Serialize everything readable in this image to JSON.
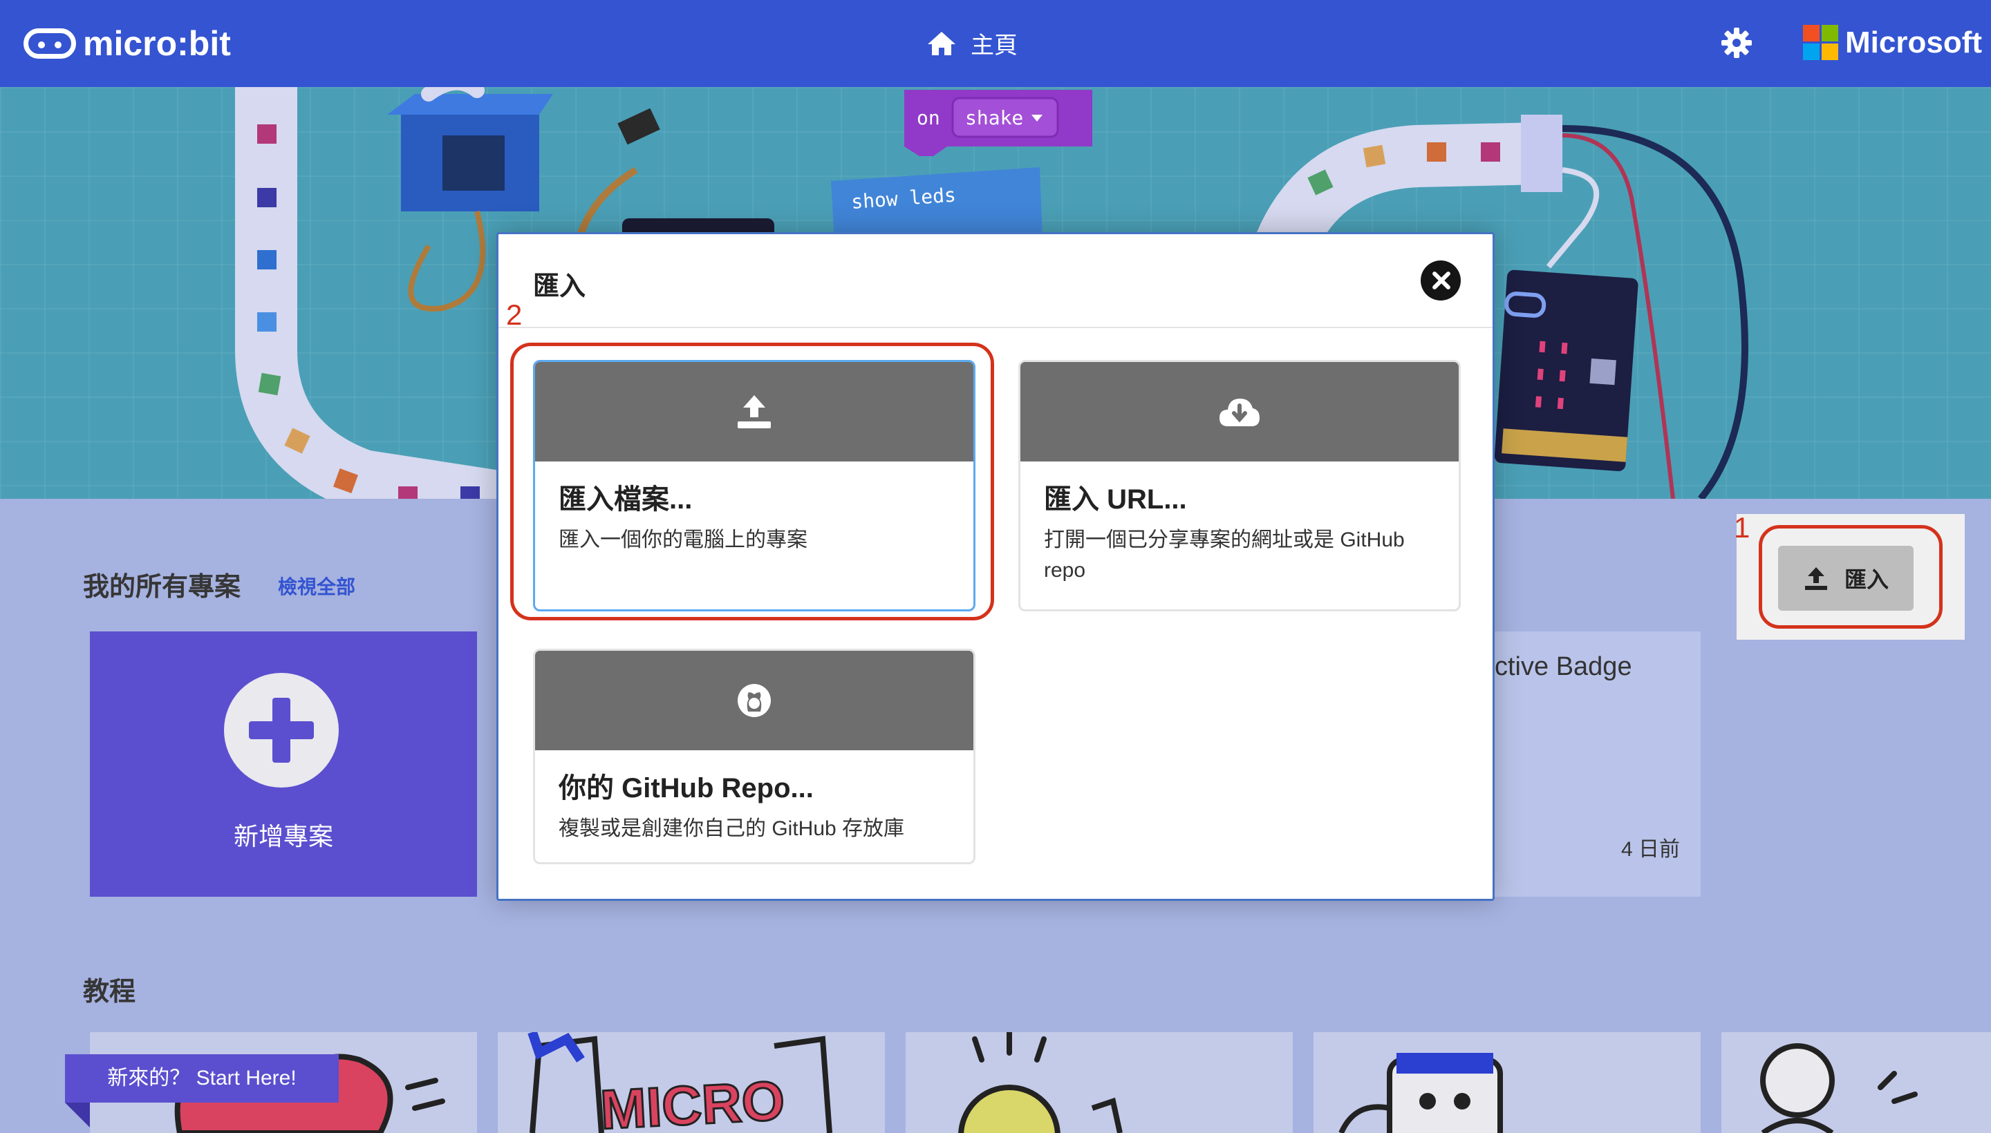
{
  "header": {
    "brand": "micro:bit",
    "home_label": "主頁",
    "microsoft": "Microsoft"
  },
  "hero": {
    "block_event": "on",
    "block_shake": "shake",
    "block_show_leds": "show leds"
  },
  "projects": {
    "section_title": "我的所有專案",
    "view_all": "檢視全部",
    "new_project_label": "新增專案",
    "card_title": "ctive Badge",
    "card_date": "4 日前"
  },
  "import_button": {
    "label": "匯入"
  },
  "tutorials": {
    "section_title": "教程",
    "start_banner": "新來的？ Start Here!"
  },
  "annotations": {
    "callout_1": "1",
    "callout_2": "2"
  },
  "modal": {
    "title": "匯入",
    "options": [
      {
        "title": "匯入檔案...",
        "description": "匯入一個你的電腦上的專案",
        "icon": "upload-icon"
      },
      {
        "title": "匯入 URL...",
        "description": "打開一個已分享專案的網址或是 GitHub repo",
        "icon": "cloud-download-icon"
      },
      {
        "title": "你的 GitHub Repo...",
        "description": "複製或是創建你自己的 GitHub 存放庫",
        "icon": "github-icon"
      }
    ]
  },
  "colors": {
    "header_bg": "#3454d1",
    "accent_purple": "#5b4fcf",
    "annotation_red": "#d4321c",
    "option_header_gray": "#6e6e6e"
  }
}
